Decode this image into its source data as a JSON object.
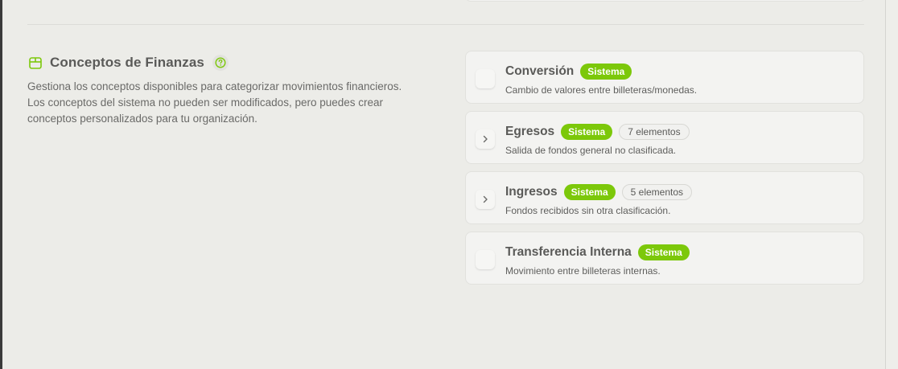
{
  "section": {
    "title": "Conceptos de Finanzas",
    "description": "Gestiona los conceptos disponibles para categorizar movimientos financieros. Los conceptos del sistema no pueden ser modificados, pero puedes crear conceptos personalizados para tu organización.",
    "title_icon": "package-icon",
    "help_icon": "help-circle-icon"
  },
  "colors": {
    "accent": "#7cc80a",
    "background": "#ecece8",
    "card": "#f3f3f1",
    "text": "#5a5a58"
  },
  "concepts": [
    {
      "name": "Conversión",
      "badge": "Sistema",
      "count": "",
      "description": "Cambio de valores entre billeteras/monedas.",
      "expandable": false
    },
    {
      "name": "Egresos",
      "badge": "Sistema",
      "count": "7 elementos",
      "description": "Salida de fondos general no clasificada.",
      "expandable": true
    },
    {
      "name": "Ingresos",
      "badge": "Sistema",
      "count": "5 elementos",
      "description": "Fondos recibidos sin otra clasificación.",
      "expandable": true
    },
    {
      "name": "Transferencia Interna",
      "badge": "Sistema",
      "count": "",
      "description": "Movimiento entre billeteras internas.",
      "expandable": false
    }
  ]
}
